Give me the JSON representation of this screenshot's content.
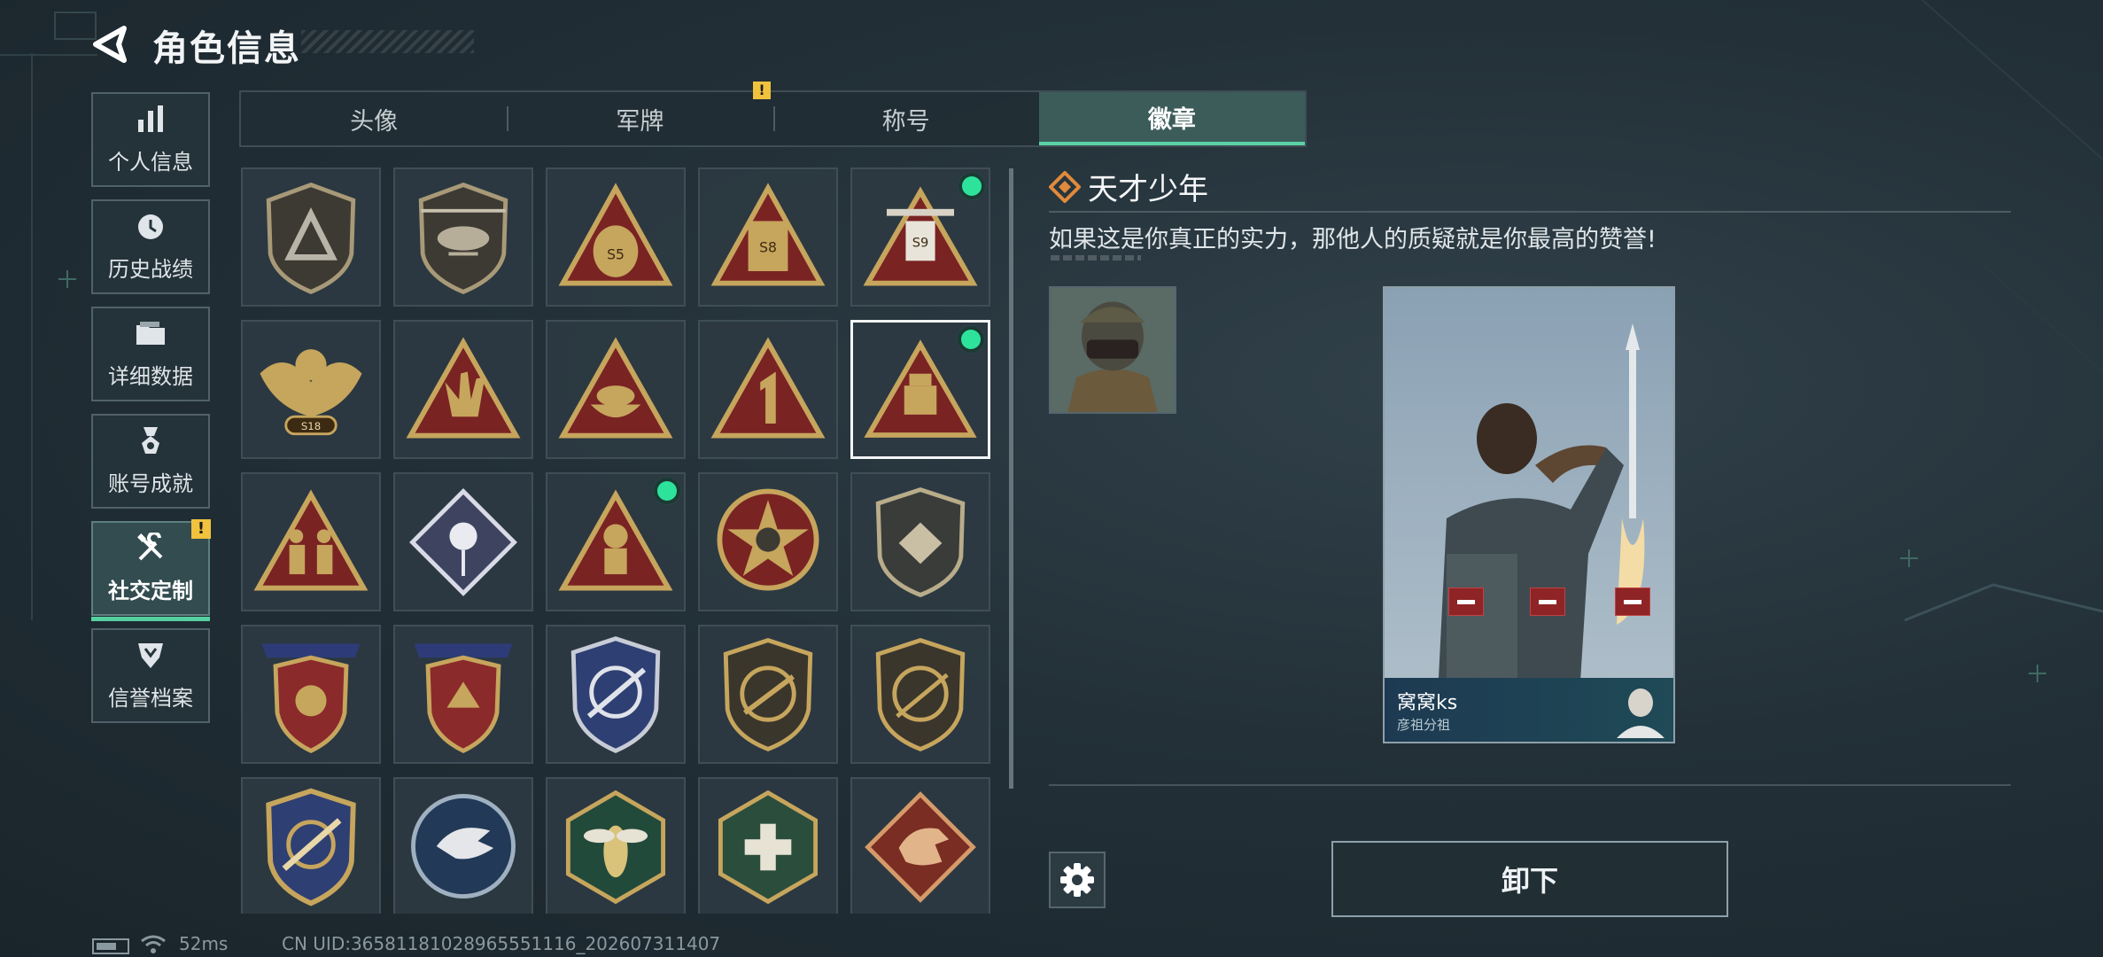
{
  "header": {
    "title": "角色信息"
  },
  "sidebar": {
    "items": [
      {
        "label": "个人信息",
        "icon": "bar-chart-icon"
      },
      {
        "label": "历史战绩",
        "icon": "history-clock-icon"
      },
      {
        "label": "详细数据",
        "icon": "folder-icon"
      },
      {
        "label": "账号成就",
        "icon": "medal-icon"
      },
      {
        "label": "社交定制",
        "icon": "tools-icon",
        "active": true,
        "warning": "!"
      },
      {
        "label": "信誉档案",
        "icon": "shield-rank-icon"
      }
    ]
  },
  "tabs": [
    {
      "label": "头像"
    },
    {
      "label": "军牌",
      "warning": "!"
    },
    {
      "label": "称号"
    },
    {
      "label": "徽章",
      "active": true
    }
  ],
  "badges": {
    "equipped_rows": [
      [
        4
      ],
      [
        4
      ],
      [
        2
      ]
    ],
    "selected": [
      1,
      4
    ]
  },
  "detail": {
    "name": "天才少年",
    "description": "如果这是你真正的实力，那他人的质疑就是你最高的赞誉!"
  },
  "card": {
    "player_name": "窝窝ks",
    "subtitle": "彦祖分祖"
  },
  "actions": {
    "unequip_label": "卸下"
  },
  "status_bar": {
    "ping": "52ms",
    "uid": "CN UID:36581181028965551116_202607311407"
  },
  "colors": {
    "accent_green": "#55d1a1",
    "warning_yellow": "#f0c23d",
    "equipped_dot": "#2de39c",
    "remove_red": "#8e2426"
  }
}
